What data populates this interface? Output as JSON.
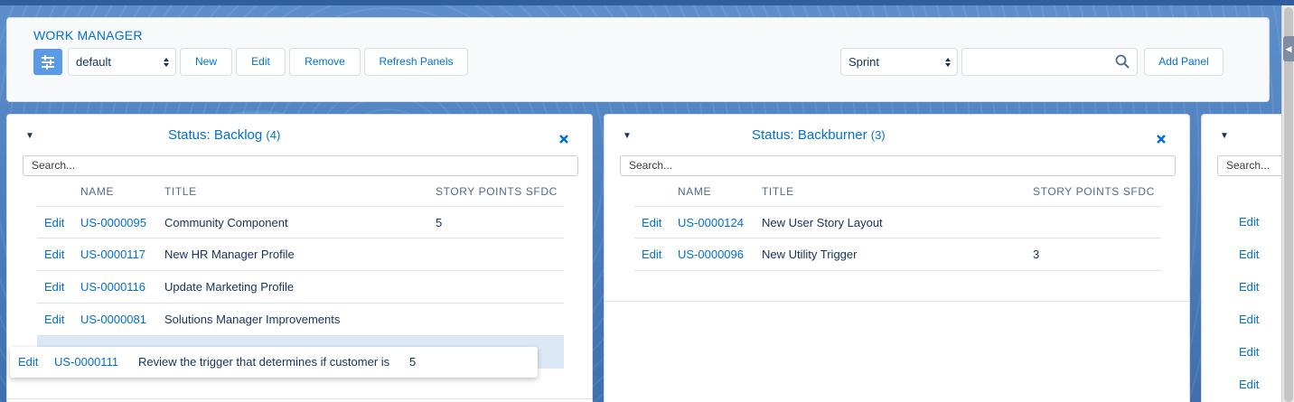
{
  "header": {
    "title": "WORK MANAGER",
    "view_select": "default",
    "buttons": {
      "new": "New",
      "edit": "Edit",
      "remove": "Remove",
      "refresh": "Refresh Panels",
      "add_panel": "Add Panel"
    },
    "sprint_select": "Sprint",
    "search_value": ""
  },
  "columns": {
    "name": "NAME",
    "title": "TITLE",
    "points": "STORY POINTS SFDC"
  },
  "panels": [
    {
      "title": "Status: Backlog",
      "count": "(4)",
      "search_placeholder": "Search...",
      "rows": [
        {
          "action": "Edit",
          "name": "US-0000095",
          "title": "Community Component",
          "points": "5"
        },
        {
          "action": "Edit",
          "name": "US-0000117",
          "title": "New HR Manager Profile",
          "points": ""
        },
        {
          "action": "Edit",
          "name": "US-0000116",
          "title": "Update Marketing Profile",
          "points": ""
        },
        {
          "action": "Edit",
          "name": "US-0000081",
          "title": "Solutions Manager Improvements",
          "points": ""
        }
      ]
    },
    {
      "title": "Status: Backburner",
      "count": "(3)",
      "search_placeholder": "Search...",
      "rows": [
        {
          "action": "Edit",
          "name": "US-0000124",
          "title": "New User Story Layout",
          "points": ""
        },
        {
          "action": "Edit",
          "name": "US-0000096",
          "title": "New Utility Trigger",
          "points": "3"
        }
      ]
    },
    {
      "search_placeholder": "Search...",
      "edit_links": [
        "Edit",
        "Edit",
        "Edit",
        "Edit",
        "Edit",
        "Edit"
      ]
    }
  ],
  "dragging_row": {
    "action": "Edit",
    "name": "US-0000111",
    "title": "Review the trigger that determines if customer is",
    "points": "5"
  },
  "icons": {
    "view": "dashboard-icon",
    "search": "search-icon",
    "close": "close-icon",
    "collapse": "chevron-down-icon"
  },
  "colors": {
    "accent": "#0070d2",
    "background": "#4f7fbe",
    "highlight": "#dbe9f7"
  }
}
